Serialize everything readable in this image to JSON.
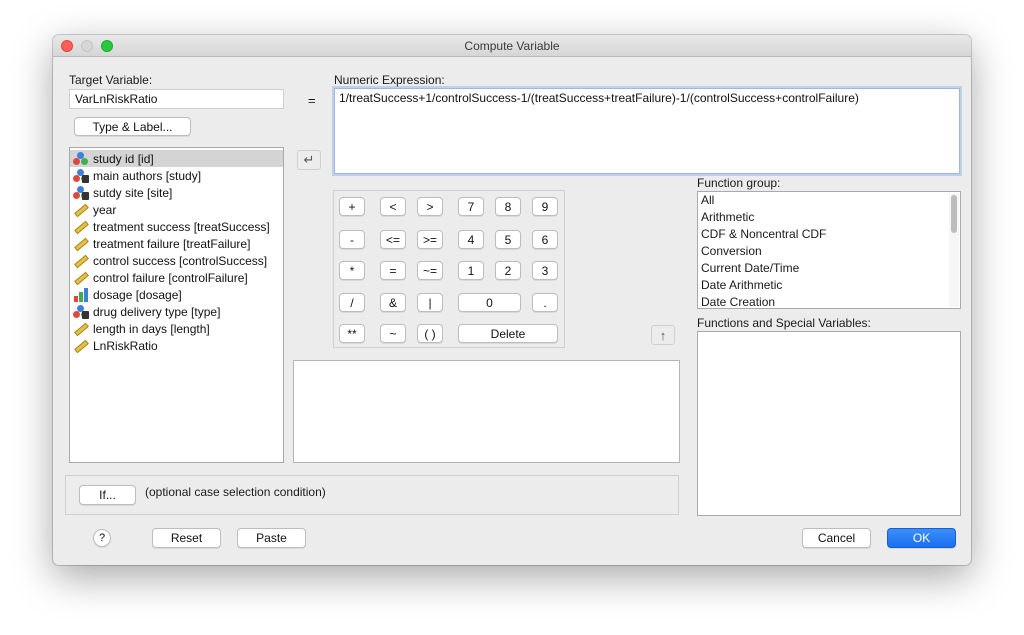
{
  "window": {
    "title": "Compute Variable"
  },
  "target": {
    "label": "Target Variable:",
    "value": "VarLnRiskRatio",
    "type_label_button": "Type & Label..."
  },
  "equals": "=",
  "expression": {
    "label": "Numeric Expression:",
    "value": "1/treatSuccess+1/controlSuccess-1/(treatSuccess+treatFailure)-1/(controlSuccess+controlFailure)"
  },
  "variables": [
    {
      "label": "study id [id]",
      "icon": "nominal-icon",
      "selected": true
    },
    {
      "label": "main authors [study]",
      "icon": "nominal-string-icon",
      "selected": false
    },
    {
      "label": "sutdy site [site]",
      "icon": "nominal-string-icon",
      "selected": false
    },
    {
      "label": "year",
      "icon": "scale-icon",
      "selected": false
    },
    {
      "label": "treatment success [treatSuccess]",
      "icon": "scale-icon",
      "selected": false
    },
    {
      "label": "treatment failure [treatFailure]",
      "icon": "scale-icon",
      "selected": false
    },
    {
      "label": "control success [controlSuccess]",
      "icon": "scale-icon",
      "selected": false
    },
    {
      "label": "control failure [controlFailure]",
      "icon": "scale-icon",
      "selected": false
    },
    {
      "label": "dosage [dosage]",
      "icon": "ordinal-icon",
      "selected": false
    },
    {
      "label": "drug delivery type [type]",
      "icon": "nominal-string-icon",
      "selected": false
    },
    {
      "label": "length in days [length]",
      "icon": "scale-icon",
      "selected": false
    },
    {
      "label": "LnRiskRatio",
      "icon": "scale-icon",
      "selected": false
    }
  ],
  "keypad": {
    "plus": "+",
    "less": "<",
    "greater": ">",
    "seven": "7",
    "eight": "8",
    "nine": "9",
    "minus": "-",
    "less_equal": "<=",
    "greater_equal": ">=",
    "four": "4",
    "five": "5",
    "six": "6",
    "multiply": "*",
    "equal": "=",
    "not_equal": "~=",
    "one": "1",
    "two": "2",
    "three": "3",
    "divide": "/",
    "and": "&",
    "or": "|",
    "zero": "0",
    "decimal": ".",
    "power": "**",
    "not": "~",
    "parens": "( )",
    "delete": "Delete"
  },
  "function_group": {
    "label": "Function group:",
    "items": [
      "All",
      "Arithmetic",
      "CDF & Noncentral CDF",
      "Conversion",
      "Current Date/Time",
      "Date Arithmetic",
      "Date Creation"
    ]
  },
  "functions": {
    "label": "Functions and Special Variables:"
  },
  "if_section": {
    "button": "If...",
    "text": "(optional case selection condition)"
  },
  "footer": {
    "help": "?",
    "reset": "Reset",
    "paste": "Paste",
    "cancel": "Cancel",
    "ok": "OK"
  }
}
